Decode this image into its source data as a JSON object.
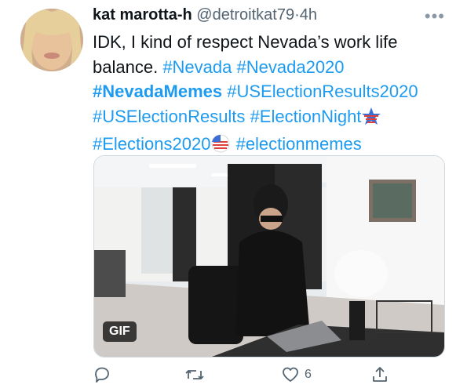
{
  "tweet": {
    "display_name": "kat marotta-h",
    "handle": "@detroitkat79",
    "separator": "·",
    "time": "4h",
    "more_label": "•••",
    "text_intro": "IDK, I kind of respect Nevada’s work life balance.",
    "hashtags": [
      "#Nevada",
      "#Nevada2020",
      "#NevadaMemes",
      "#USElectionResults2020",
      "#USElectionResults",
      "#ElectionNight",
      "#Elections2020",
      "#electionmemes"
    ]
  },
  "media": {
    "badge": "GIF"
  },
  "actions": {
    "reply_icon": "reply-icon",
    "retweet_icon": "retweet-icon",
    "like_icon": "heart-icon",
    "like_count": "6",
    "share_icon": "share-icon"
  },
  "colors": {
    "link": "#1d9bf0",
    "text": "#0f1419",
    "muted": "#536471"
  }
}
